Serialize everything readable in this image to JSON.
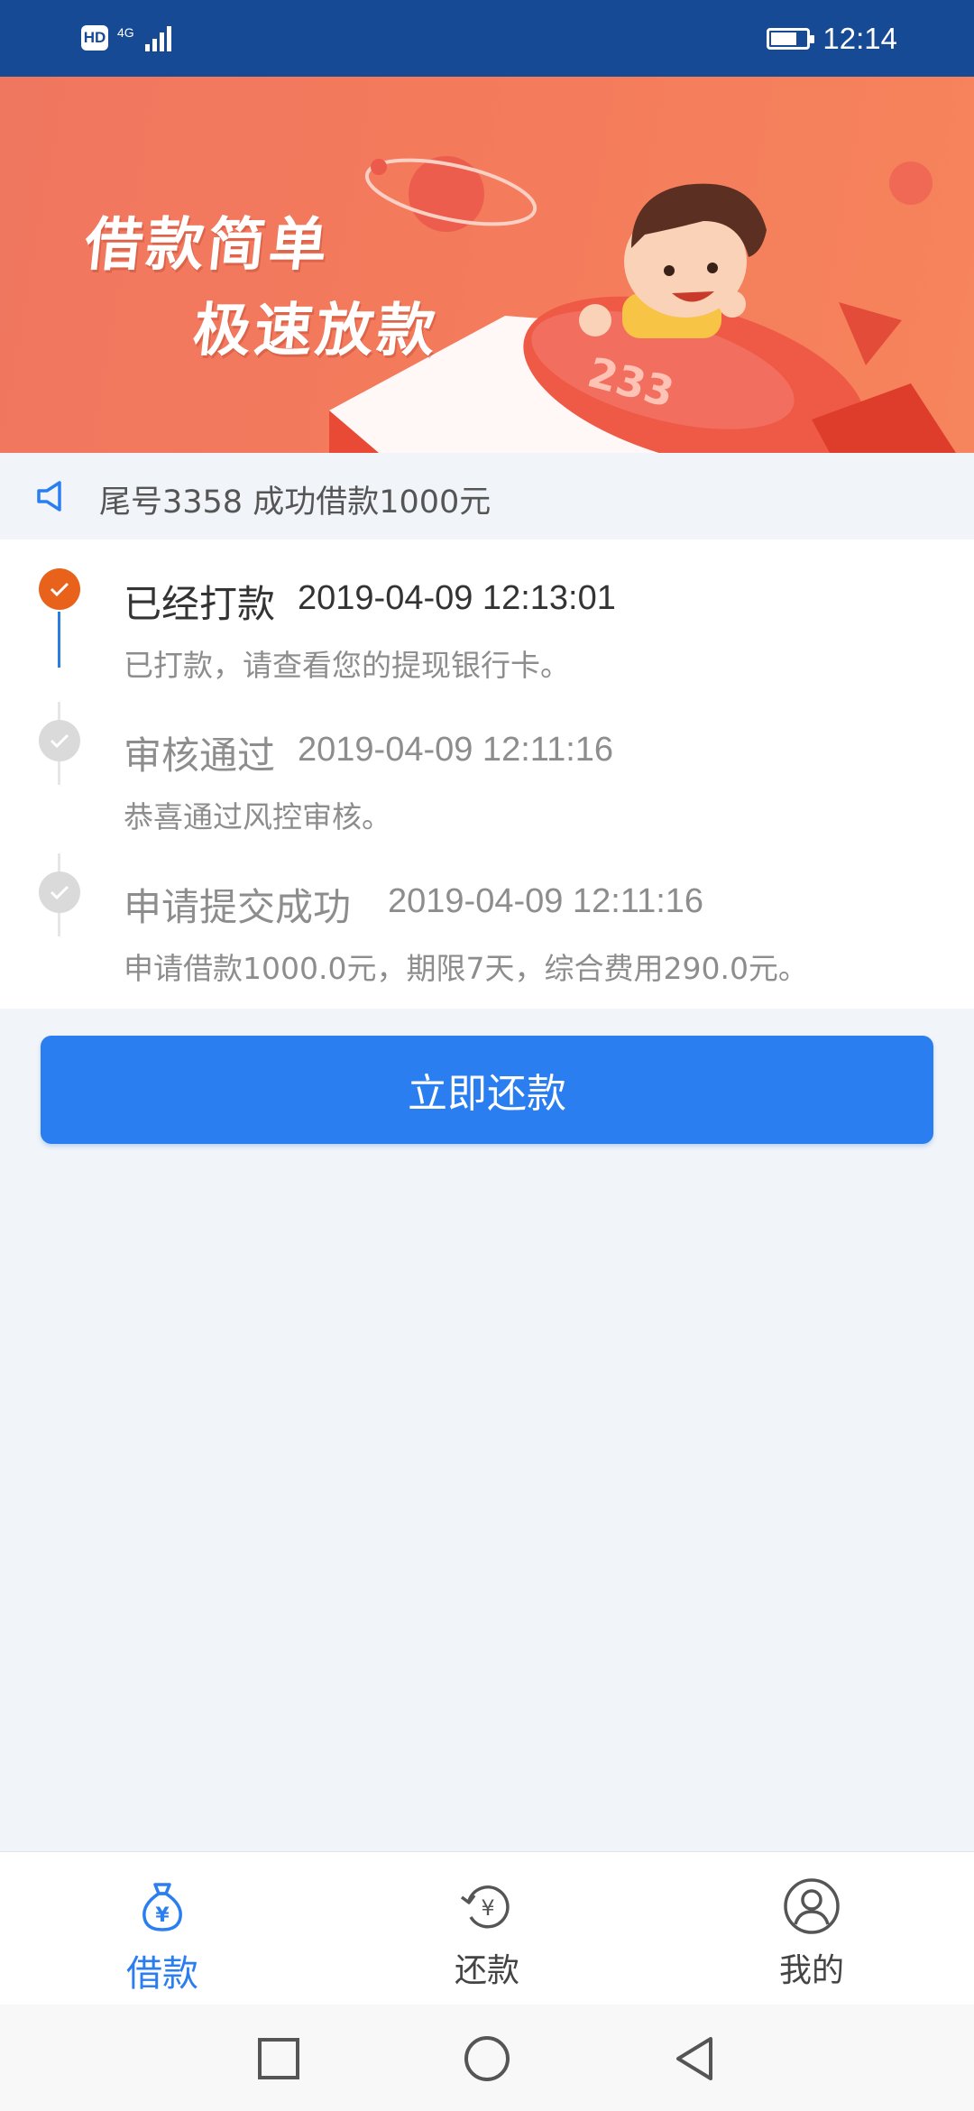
{
  "status_bar": {
    "hd": "HD",
    "network": "4G",
    "time": "12:14"
  },
  "banner": {
    "line1": "借款简单",
    "line2": "极速放款",
    "rocket_number": "233"
  },
  "notice": {
    "text": "尾号3358 成功借款1000元"
  },
  "timeline": [
    {
      "title": "已经打款",
      "time": "2019-04-09 12:13:01",
      "desc": "已打款，请查看您的提现银行卡。",
      "state": "done"
    },
    {
      "title": "审核通过",
      "time": "2019-04-09 12:11:16",
      "desc": "恭喜通过风控审核。",
      "state": "past"
    },
    {
      "title": "申请提交成功",
      "time": "2019-04-09 12:11:16",
      "desc": "申请借款1000.0元，期限7天，综合费用290.0元。",
      "state": "past"
    }
  ],
  "repay_button": {
    "label": "立即还款"
  },
  "tabs": [
    {
      "label": "借款",
      "icon": "money-bag-icon",
      "active": true
    },
    {
      "label": "还款",
      "icon": "repay-cycle-icon",
      "active": false
    },
    {
      "label": "我的",
      "icon": "user-icon",
      "active": false
    }
  ],
  "colors": {
    "status_bar": "#174a95",
    "accent": "#2a7ef0",
    "done_dot": "#e8621c",
    "banner": "#f47a5c"
  }
}
